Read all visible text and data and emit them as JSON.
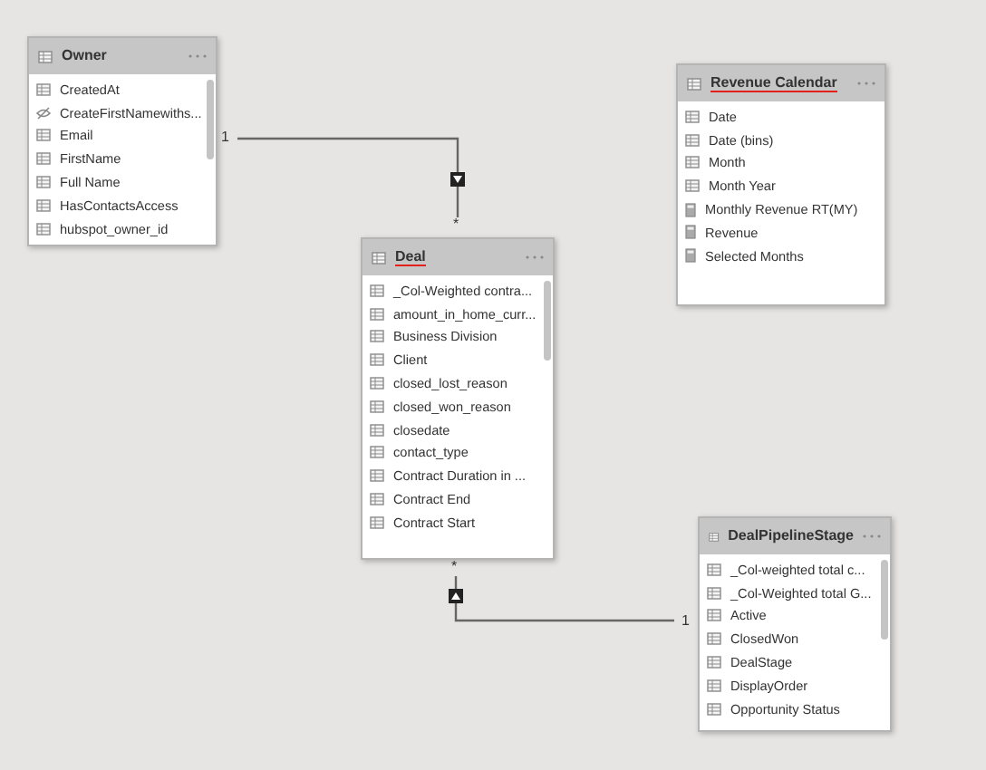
{
  "tables": [
    {
      "title": "Owner",
      "highlighted": false,
      "scrollbar": true,
      "fields": [
        {
          "name": "CreatedAt",
          "kind": "column"
        },
        {
          "name": "CreateFirstNamewiths...",
          "kind": "hidden"
        },
        {
          "name": "Email",
          "kind": "column"
        },
        {
          "name": "FirstName",
          "kind": "column"
        },
        {
          "name": "Full Name",
          "kind": "column"
        },
        {
          "name": "HasContactsAccess",
          "kind": "column"
        },
        {
          "name": "hubspot_owner_id",
          "kind": "column"
        }
      ]
    },
    {
      "title": "Deal",
      "highlighted": true,
      "scrollbar": true,
      "fields": [
        {
          "name": "_Col-Weighted contra...",
          "kind": "column"
        },
        {
          "name": "amount_in_home_curr...",
          "kind": "column"
        },
        {
          "name": "Business Division",
          "kind": "column"
        },
        {
          "name": "Client",
          "kind": "column"
        },
        {
          "name": "closed_lost_reason",
          "kind": "column"
        },
        {
          "name": "closed_won_reason",
          "kind": "column"
        },
        {
          "name": "closedate",
          "kind": "column"
        },
        {
          "name": "contact_type",
          "kind": "column"
        },
        {
          "name": "Contract Duration in ...",
          "kind": "column"
        },
        {
          "name": "Contract End",
          "kind": "column"
        },
        {
          "name": "Contract Start",
          "kind": "column"
        }
      ]
    },
    {
      "title": "Revenue Calendar",
      "highlighted": true,
      "scrollbar": false,
      "fields": [
        {
          "name": "Date",
          "kind": "column"
        },
        {
          "name": "Date (bins)",
          "kind": "column"
        },
        {
          "name": "Month",
          "kind": "column"
        },
        {
          "name": "Month Year",
          "kind": "column"
        },
        {
          "name": "Monthly Revenue RT(MY)",
          "kind": "measure"
        },
        {
          "name": "Revenue",
          "kind": "measure"
        },
        {
          "name": "Selected Months",
          "kind": "measure"
        }
      ]
    },
    {
      "title": "DealPipelineStage",
      "highlighted": false,
      "scrollbar": true,
      "fields": [
        {
          "name": "_Col-weighted total c...",
          "kind": "column"
        },
        {
          "name": "_Col-Weighted total G...",
          "kind": "column"
        },
        {
          "name": "Active",
          "kind": "column"
        },
        {
          "name": "ClosedWon",
          "kind": "column"
        },
        {
          "name": "DealStage",
          "kind": "column"
        },
        {
          "name": "DisplayOrder",
          "kind": "column"
        },
        {
          "name": "Opportunity Status",
          "kind": "column"
        }
      ]
    }
  ],
  "relationships": [
    {
      "one_label": "1",
      "many_label": "*"
    },
    {
      "one_label": "1",
      "many_label": "*"
    }
  ]
}
